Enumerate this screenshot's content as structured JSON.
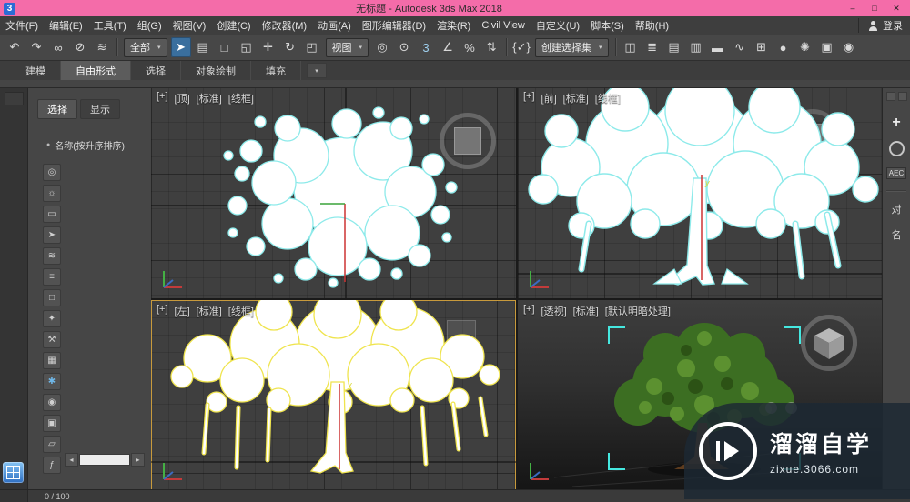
{
  "titlebar": {
    "icon_text": "3",
    "title": "无标题 - Autodesk 3ds Max 2018",
    "controls": [
      {
        "name": "minimize-button",
        "glyph": "–"
      },
      {
        "name": "maximize-button",
        "glyph": "□"
      },
      {
        "name": "close-button",
        "glyph": "✕"
      }
    ]
  },
  "menubar": {
    "items": [
      {
        "name": "menu-file",
        "label": "文件(F)"
      },
      {
        "name": "menu-edit",
        "label": "编辑(E)"
      },
      {
        "name": "menu-tools",
        "label": "工具(T)"
      },
      {
        "name": "menu-group",
        "label": "组(G)"
      },
      {
        "name": "menu-views",
        "label": "视图(V)"
      },
      {
        "name": "menu-create",
        "label": "创建(C)"
      },
      {
        "name": "menu-modifiers",
        "label": "修改器(M)"
      },
      {
        "name": "menu-animation",
        "label": "动画(A)"
      },
      {
        "name": "menu-graph-editors",
        "label": "图形编辑器(D)"
      },
      {
        "name": "menu-rendering",
        "label": "渲染(R)"
      },
      {
        "name": "menu-civil-view",
        "label": "Civil View"
      },
      {
        "name": "menu-customize",
        "label": "自定义(U)"
      },
      {
        "name": "menu-scripting",
        "label": "脚本(S)"
      },
      {
        "name": "menu-help",
        "label": "帮助(H)"
      }
    ],
    "login_label": "登录"
  },
  "toolbar": {
    "group1": [
      {
        "name": "undo-button",
        "glyph": "↶"
      },
      {
        "name": "redo-button",
        "glyph": "↷"
      },
      {
        "name": "select-and-link-button",
        "glyph": "∞"
      },
      {
        "name": "unlink-selection-button",
        "glyph": "⊘"
      },
      {
        "name": "bind-to-space-warp-button",
        "glyph": "≋"
      }
    ],
    "filter_select": {
      "label": "全部"
    },
    "group2": [
      {
        "name": "select-object-button",
        "glyph": "➤",
        "active": true
      },
      {
        "name": "select-by-name-button",
        "glyph": "▤"
      },
      {
        "name": "rectangular-selection-button",
        "glyph": "□"
      },
      {
        "name": "window-crossing-button",
        "glyph": "◱"
      },
      {
        "name": "select-and-move-button",
        "glyph": "✛"
      },
      {
        "name": "select-and-rotate-button",
        "glyph": "↻"
      },
      {
        "name": "select-and-scale-button",
        "glyph": "◰"
      }
    ],
    "coord_select": {
      "label": "视图"
    },
    "group3": [
      {
        "name": "use-pivot-point-button",
        "glyph": "◎"
      },
      {
        "name": "use-selection-center-button",
        "glyph": "⊙"
      },
      {
        "name": "snaps-toggle-button",
        "glyph": "3",
        "color": "#9fd0ef"
      },
      {
        "name": "angle-snap-button",
        "glyph": "∠"
      },
      {
        "name": "percent-snap-button",
        "glyph": "%"
      },
      {
        "name": "spinner-snap-button",
        "glyph": "⇅"
      }
    ],
    "named_sets_button": {
      "glyph": "{✓}"
    },
    "selection_set_select": {
      "label": "创建选择集"
    },
    "group4": [
      {
        "name": "mirror-button",
        "glyph": "◫"
      },
      {
        "name": "align-button",
        "glyph": "≣"
      },
      {
        "name": "scene-explorer-button",
        "glyph": "▤"
      },
      {
        "name": "layer-explorer-button",
        "glyph": "▥"
      },
      {
        "name": "ribbon-toggle-button",
        "glyph": "▬"
      },
      {
        "name": "curve-editor-button",
        "glyph": "∿"
      },
      {
        "name": "schematic-view-button",
        "glyph": "⊞"
      },
      {
        "name": "material-editor-button",
        "glyph": "●"
      },
      {
        "name": "render-setup-button",
        "glyph": "✺"
      },
      {
        "name": "rendered-frame-button",
        "glyph": "▣"
      },
      {
        "name": "render-button",
        "glyph": "◉"
      }
    ]
  },
  "ribbon": {
    "tabs": [
      {
        "name": "tab-modeling",
        "label": "建模"
      },
      {
        "name": "tab-freeform",
        "label": "自由形式",
        "active": true
      },
      {
        "name": "tab-selection",
        "label": "选择"
      },
      {
        "name": "tab-object-paint",
        "label": "对象绘制"
      },
      {
        "name": "tab-populate",
        "label": "填充"
      }
    ]
  },
  "icons": {
    "caret": "▾",
    "bullet": "●",
    "left_arrow": "◂",
    "right_arrow": "▸",
    "plus": "+"
  },
  "left_panel": {
    "tabs": [
      {
        "name": "tab-select",
        "label": "选择",
        "active": true
      },
      {
        "name": "tab-display",
        "label": "显示"
      }
    ],
    "sort_label": "名称(按升序排序)",
    "tools": [
      {
        "name": "pin-icon",
        "glyph": "◎"
      },
      {
        "name": "bulb-icon",
        "glyph": "☼"
      },
      {
        "name": "monitor-icon",
        "glyph": "▭"
      },
      {
        "name": "cursor-icon",
        "glyph": "➤"
      },
      {
        "name": "wave-icon",
        "glyph": "≋"
      },
      {
        "name": "layers-icon",
        "glyph": "≡"
      },
      {
        "name": "region-icon",
        "glyph": "□"
      },
      {
        "name": "lamp-icon",
        "glyph": "✦"
      },
      {
        "name": "wrench-icon",
        "glyph": "⚒"
      },
      {
        "name": "grid-icon",
        "glyph": "▦"
      },
      {
        "name": "snowflake-icon",
        "glyph": "✱",
        "color": "#6fb7e8"
      },
      {
        "name": "eye-icon",
        "glyph": "◉"
      },
      {
        "name": "geometry-icon",
        "glyph": "▣"
      },
      {
        "name": "shape-icon",
        "glyph": "▱"
      },
      {
        "name": "freeze-icon",
        "glyph": "ƒ"
      }
    ]
  },
  "viewports": {
    "top": {
      "labels": [
        {
          "name": "viewport-general-menu",
          "label": "[+]"
        },
        {
          "name": "viewport-pov-menu",
          "label": "[顶]"
        },
        {
          "name": "viewport-standard-menu",
          "label": "[标准]"
        },
        {
          "name": "viewport-shading-menu",
          "label": "[线框]"
        }
      ]
    },
    "front": {
      "labels": [
        {
          "name": "viewport-general-menu",
          "label": "[+]"
        },
        {
          "name": "viewport-pov-menu",
          "label": "[前]"
        },
        {
          "name": "viewport-standard-menu",
          "label": "[标准]"
        },
        {
          "name": "viewport-shading-menu",
          "label": "[线框]"
        }
      ]
    },
    "left": {
      "labels": [
        {
          "name": "viewport-general-menu",
          "label": "[+]"
        },
        {
          "name": "viewport-pov-menu",
          "label": "[左]"
        },
        {
          "name": "viewport-standard-menu",
          "label": "[标准]"
        },
        {
          "name": "viewport-shading-menu",
          "label": "[线框]"
        }
      ]
    },
    "perspective": {
      "labels": [
        {
          "name": "viewport-general-menu",
          "label": "[+]"
        },
        {
          "name": "viewport-pov-menu",
          "label": "[透视]"
        },
        {
          "name": "viewport-standard-menu",
          "label": "[标准]"
        },
        {
          "name": "viewport-shading-menu",
          "label": "[默认明暗处理]"
        }
      ]
    }
  },
  "axes": {
    "y": "y"
  },
  "right_panel": {
    "aec_label": "AEC",
    "rollouts": [
      {
        "name": "rollout-object-type",
        "label": "对"
      },
      {
        "name": "rollout-name-color",
        "label": "名"
      }
    ]
  },
  "statusbar": {
    "frame_counter": "0 / 100"
  },
  "watermark": {
    "brand": "溜溜自学",
    "site": "zixue.3066.com"
  }
}
